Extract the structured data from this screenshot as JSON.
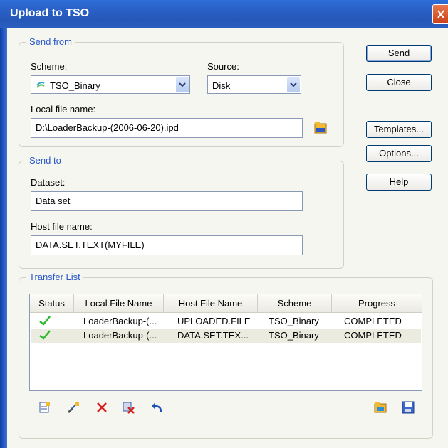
{
  "window": {
    "title": "Upload to TSO"
  },
  "send_from": {
    "legend": "Send from",
    "scheme_label": "Scheme:",
    "scheme_value": "TSO_Binary",
    "source_label": "Source:",
    "source_value": "Disk",
    "local_file_label": "Local file name:",
    "local_file_value": "D:\\LoaderBackup-(2006-06-20).ipd"
  },
  "send_to": {
    "legend": "Send to",
    "dataset_label": "Dataset:",
    "dataset_value": "Data set",
    "host_file_label": "Host file name:",
    "host_file_value": "DATA.SET.TEXT(MYFILE)"
  },
  "buttons": {
    "send": "Send",
    "close": "Close",
    "templates": "Templates...",
    "options": "Options...",
    "help": "Help"
  },
  "transfer_list": {
    "legend": "Transfer List",
    "columns": [
      "Status",
      "Local File Name",
      "Host File Name",
      "Scheme",
      "Progress"
    ],
    "rows": [
      {
        "local": "LoaderBackup-(...",
        "host": "UPLOADED.FILE",
        "scheme": "TSO_Binary",
        "progress": "COMPLETED"
      },
      {
        "local": "LoaderBackup-(...",
        "host": "DATA.SET.TEX...",
        "scheme": "TSO_Binary",
        "progress": "COMPLETED"
      }
    ]
  },
  "icons": {
    "scheme": "tso-scheme-icon",
    "browse": "folder-browse-icon",
    "status": "checkmark-icon",
    "toolbar": [
      "edit-item-icon",
      "edit-properties-icon",
      "delete-icon",
      "cancel-transfer-icon",
      "undo-icon",
      "open-folder-icon",
      "save-icon"
    ]
  },
  "colors": {
    "accent": "#2a58c7",
    "check": "#2eb82e",
    "delete": "#d61f1f",
    "titlebar": "#2557b8"
  }
}
